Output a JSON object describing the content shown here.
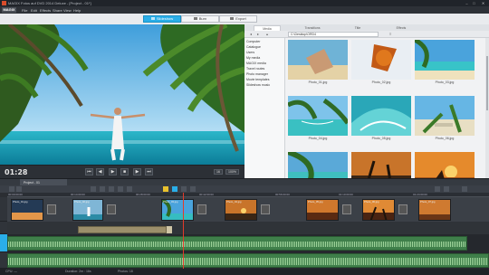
{
  "window": {
    "title": "MAGIX Fotos auf DVD 2014 Deluxe - [Project - 01*]"
  },
  "menu": {
    "brand": "MAGIX",
    "items": [
      "File",
      "Edit",
      "Effects",
      "Share",
      "View",
      "Help"
    ]
  },
  "modes": {
    "active": "Slideshow",
    "items": [
      "Slideshow",
      "Burn",
      "Export"
    ]
  },
  "preview": {
    "timecode": "01:28",
    "zoom": "100%"
  },
  "pool": {
    "tabs": [
      "Media",
      "Transitions",
      "Title",
      "Effects"
    ],
    "active_tab": "Media",
    "path": "C:\\Desktop\\ORD4",
    "tree": [
      "Computer",
      "Catalogue",
      "Users",
      "My media",
      "MAGIX media",
      "Travel routes",
      "Photo manager",
      "Movie templates",
      "Slideshow music"
    ],
    "thumbs": [
      {
        "caption": "Photo_01.jpg"
      },
      {
        "caption": "Photo_02.jpg"
      },
      {
        "caption": "Photo_03.jpg"
      },
      {
        "caption": "Photo_04.jpg"
      },
      {
        "caption": "Photo_05.jpg"
      },
      {
        "caption": "Photo_06.jpg"
      },
      {
        "caption": ""
      },
      {
        "caption": ""
      },
      {
        "caption": ""
      }
    ]
  },
  "timeline": {
    "project_tab": "Project - 01",
    "ruler": [
      "00:00:00:00",
      "00:14:00:00",
      "00:28:00:00",
      "00:42:00:00",
      "00:56:00:00",
      "01:10:00:00",
      "01:24:00:00",
      "01:38:00:00",
      "01:52:00:00",
      "02:06:00:00"
    ],
    "clip_labels": [
      "Photo_01.jpg",
      "Photo_02.jpg",
      "Photo_03.jpg",
      "Photo_04.jpg",
      "Photo_05.jpg",
      "Photo_06.jpg",
      "Photo_07.jpg",
      "Photo_08.jpg"
    ]
  },
  "status": {
    "left": "CPU: —",
    "mid": "Duration: 2m : 16s",
    "right": "Photos: 18"
  },
  "colors": {
    "accent": "#2aaee8",
    "playhead": "#e23a2a",
    "audio": "#3f7f4a"
  }
}
